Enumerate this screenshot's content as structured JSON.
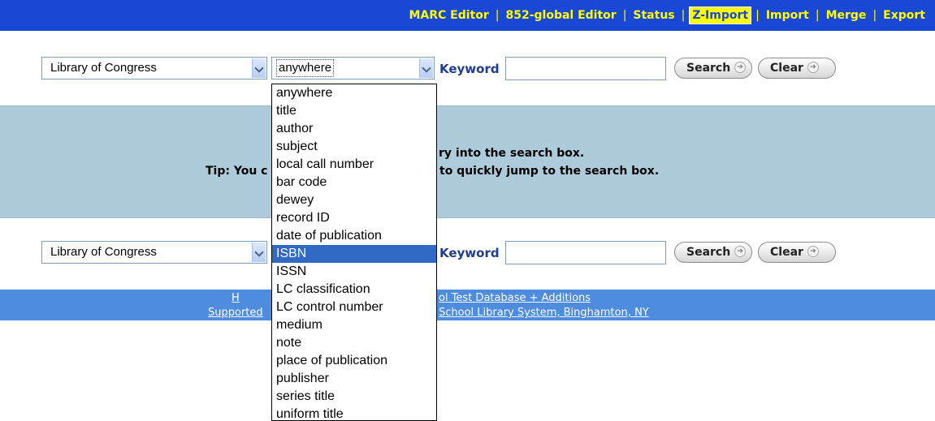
{
  "nav": {
    "items": [
      {
        "label": "MARC Editor",
        "active": false
      },
      {
        "label": "852-global Editor",
        "active": false
      },
      {
        "label": "Status",
        "active": false
      },
      {
        "label": "Z-Import",
        "active": true
      },
      {
        "label": "Import",
        "active": false
      },
      {
        "label": "Merge",
        "active": false
      },
      {
        "label": "Export",
        "active": false
      }
    ],
    "separator": "|"
  },
  "search_top": {
    "source": "Library of Congress",
    "field": "anywhere",
    "keyword_label": "Keyword",
    "keyword_value": "",
    "search_label": "Search",
    "clear_label": "Clear"
  },
  "search_bottom": {
    "source": "Library of Congress",
    "field": "ISBN",
    "keyword_label": "Keyword",
    "keyword_value": "",
    "search_label": "Search",
    "clear_label": "Clear"
  },
  "tip": {
    "line1_visible": "ry into the search box.",
    "line2_prefix": "Tip: You c",
    "line2_visible": "to quickly jump to the search box."
  },
  "footer": {
    "line1_left": "H",
    "line1_right": "ol Test Database + Additions",
    "line2_left": "Supported",
    "line2_right": "School Library System, Binghamton, NY"
  },
  "dropdown": {
    "options": [
      "anywhere",
      "title",
      "author",
      "subject",
      "local call number",
      "bar code",
      "dewey",
      "record ID",
      "date of publication",
      "ISBN",
      "ISSN",
      "LC classification",
      "LC control number",
      "medium",
      "note",
      "place of publication",
      "publisher",
      "series title",
      "uniform title"
    ],
    "highlighted": "ISBN"
  },
  "colors": {
    "nav_bg": "#1a48d6",
    "nav_text": "#ffff00",
    "tip_bg": "#aecbdc",
    "footer_bg": "#4e8cdf",
    "highlight": "#316ac5",
    "keyword_label": "#1f3c92"
  }
}
